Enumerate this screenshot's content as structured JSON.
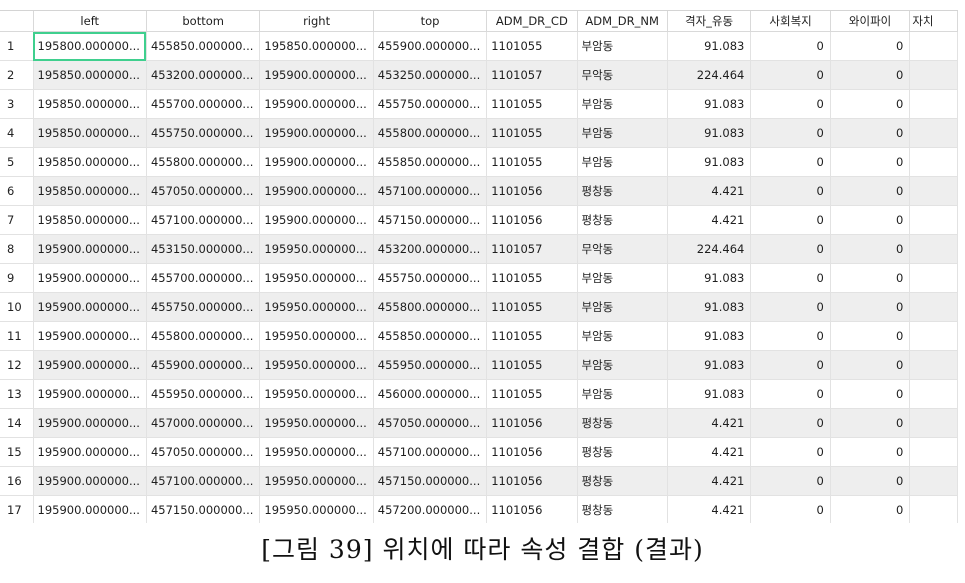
{
  "table": {
    "columns": [
      "left",
      "bottom",
      "right",
      "top",
      "ADM_DR_CD",
      "ADM_DR_NM",
      "격자_유동",
      "사회복지",
      "와이파이",
      "자치"
    ],
    "rows": [
      [
        "1",
        "195800.000000...",
        "455850.000000...",
        "195850.000000...",
        "455900.000000...",
        "1101055",
        "부암동",
        "91.083",
        "0",
        "0"
      ],
      [
        "2",
        "195850.000000...",
        "453200.000000...",
        "195900.000000...",
        "453250.000000...",
        "1101057",
        "무악동",
        "224.464",
        "0",
        "0"
      ],
      [
        "3",
        "195850.000000...",
        "455700.000000...",
        "195900.000000...",
        "455750.000000...",
        "1101055",
        "부암동",
        "91.083",
        "0",
        "0"
      ],
      [
        "4",
        "195850.000000...",
        "455750.000000...",
        "195900.000000...",
        "455800.000000...",
        "1101055",
        "부암동",
        "91.083",
        "0",
        "0"
      ],
      [
        "5",
        "195850.000000...",
        "455800.000000...",
        "195900.000000...",
        "455850.000000...",
        "1101055",
        "부암동",
        "91.083",
        "0",
        "0"
      ],
      [
        "6",
        "195850.000000...",
        "457050.000000...",
        "195900.000000...",
        "457100.000000...",
        "1101056",
        "평창동",
        "4.421",
        "0",
        "0"
      ],
      [
        "7",
        "195850.000000...",
        "457100.000000...",
        "195900.000000...",
        "457150.000000...",
        "1101056",
        "평창동",
        "4.421",
        "0",
        "0"
      ],
      [
        "8",
        "195900.000000...",
        "453150.000000...",
        "195950.000000...",
        "453200.000000...",
        "1101057",
        "무악동",
        "224.464",
        "0",
        "0"
      ],
      [
        "9",
        "195900.000000...",
        "455700.000000...",
        "195950.000000...",
        "455750.000000...",
        "1101055",
        "부암동",
        "91.083",
        "0",
        "0"
      ],
      [
        "10",
        "195900.000000...",
        "455750.000000...",
        "195950.000000...",
        "455800.000000...",
        "1101055",
        "부암동",
        "91.083",
        "0",
        "0"
      ],
      [
        "11",
        "195900.000000...",
        "455800.000000...",
        "195950.000000...",
        "455850.000000...",
        "1101055",
        "부암동",
        "91.083",
        "0",
        "0"
      ],
      [
        "12",
        "195900.000000...",
        "455900.000000...",
        "195950.000000...",
        "455950.000000...",
        "1101055",
        "부암동",
        "91.083",
        "0",
        "0"
      ],
      [
        "13",
        "195900.000000...",
        "455950.000000...",
        "195950.000000...",
        "456000.000000...",
        "1101055",
        "부암동",
        "91.083",
        "0",
        "0"
      ],
      [
        "14",
        "195900.000000...",
        "457000.000000...",
        "195950.000000...",
        "457050.000000...",
        "1101056",
        "평창동",
        "4.421",
        "0",
        "0"
      ],
      [
        "15",
        "195900.000000...",
        "457050.000000...",
        "195950.000000...",
        "457100.000000...",
        "1101056",
        "평창동",
        "4.421",
        "0",
        "0"
      ],
      [
        "16",
        "195900.000000...",
        "457100.000000...",
        "195950.000000...",
        "457150.000000...",
        "1101056",
        "평창동",
        "4.421",
        "0",
        "0"
      ],
      [
        "17",
        "195900.000000...",
        "457150.000000...",
        "195950.000000...",
        "457200.000000...",
        "1101056",
        "평창동",
        "4.421",
        "0",
        "0"
      ]
    ]
  },
  "caption": "[그림 39] 위치에 따라 속성 결합 (결과)",
  "colors": {
    "selection": "#3fcf8e",
    "stripe": "#eeeeee",
    "gridline": "#e2e2e2"
  }
}
